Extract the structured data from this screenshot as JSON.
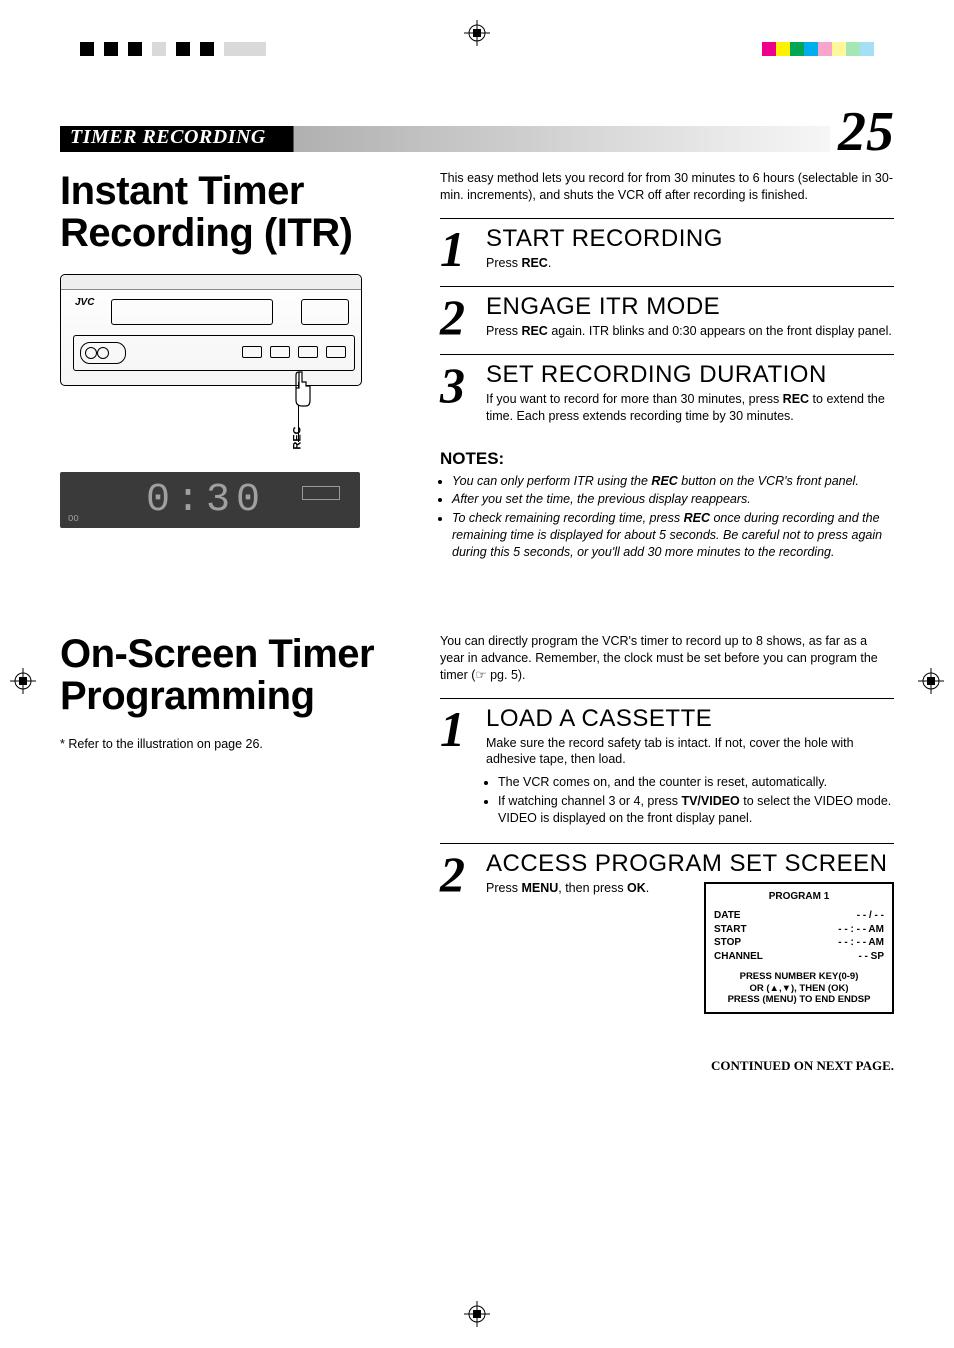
{
  "header": {
    "section_title": "TIMER RECORDING",
    "page_number": "25"
  },
  "itr": {
    "title": "Instant Timer Recording (ITR)",
    "vcr_brand": "JVC",
    "rec_label": "REC",
    "lcd_display": "0:30",
    "lcd_annun": "OO",
    "intro": "This easy method lets you record for from 30 minutes to 6 hours (selectable in 30-min. increments), and shuts the VCR off after recording is finished.",
    "steps": [
      {
        "num": "1",
        "title": "START RECORDING",
        "desc_pre": "Press ",
        "desc_bold": "REC",
        "desc_post": "."
      },
      {
        "num": "2",
        "title": "ENGAGE ITR MODE",
        "desc_pre": "Press ",
        "desc_bold": "REC",
        "desc_post": " again. ITR blinks and 0:30 appears on the front display panel."
      },
      {
        "num": "3",
        "title": "SET RECORDING DURATION",
        "desc_pre": "If you want to record for more than 30 minutes, press ",
        "desc_bold": "REC",
        "desc_post": " to extend the time. Each press extends recording time by 30 minutes."
      }
    ],
    "notes_heading": "NOTES:",
    "notes": [
      {
        "pre": "You can only perform ITR using the ",
        "bold": "REC",
        "post": " button on the VCR's front panel."
      },
      {
        "pre": "After you set the time, the previous display reappears.",
        "bold": "",
        "post": ""
      },
      {
        "pre": "To check remaining recording time, press ",
        "bold": "REC",
        "post": " once during recording and the remaining time is displayed for about 5 seconds. Be careful not to press again during this 5 seconds, or you'll add 30 more minutes to the recording."
      }
    ]
  },
  "prog": {
    "title": "On-Screen Timer Programming",
    "footnote": "*  Refer to the illustration on page 26.",
    "intro": "You can directly program the VCR's timer to record up to 8 shows, as far as a year in advance. Remember, the clock must be set before you can program the timer (☞ pg. 5).",
    "steps": [
      {
        "num": "1",
        "title": "LOAD A CASSETTE",
        "desc": "Make sure the record safety tab is intact. If not, cover the hole with adhesive tape, then load.",
        "bullets": [
          "The VCR comes on, and the counter is reset, automatically.",
          "If watching channel 3 or 4, press TV/VIDEO to select the VIDEO mode. VIDEO is displayed on the front display panel."
        ]
      },
      {
        "num": "2",
        "title": "ACCESS PROGRAM SET SCREEN",
        "desc_pre": "Press ",
        "desc_b1": "MENU",
        "desc_mid": ", then press ",
        "desc_b2": "OK",
        "desc_post": "."
      }
    ],
    "osd": {
      "title": "PROGRAM 1",
      "rows": [
        {
          "label": "DATE",
          "value": "- - / - -"
        },
        {
          "label": "START",
          "value": "- - : - -  AM"
        },
        {
          "label": "STOP",
          "value": "- - : - -  AM"
        },
        {
          "label": "CHANNEL",
          "value": "- -  SP"
        }
      ],
      "instr1": "PRESS NUMBER KEY(0-9)",
      "instr2": "OR (▲,▼), THEN (OK)",
      "instr3": "PRESS (MENU) TO END ENDSP"
    },
    "continued": "CONTINUED ON NEXT PAGE."
  }
}
